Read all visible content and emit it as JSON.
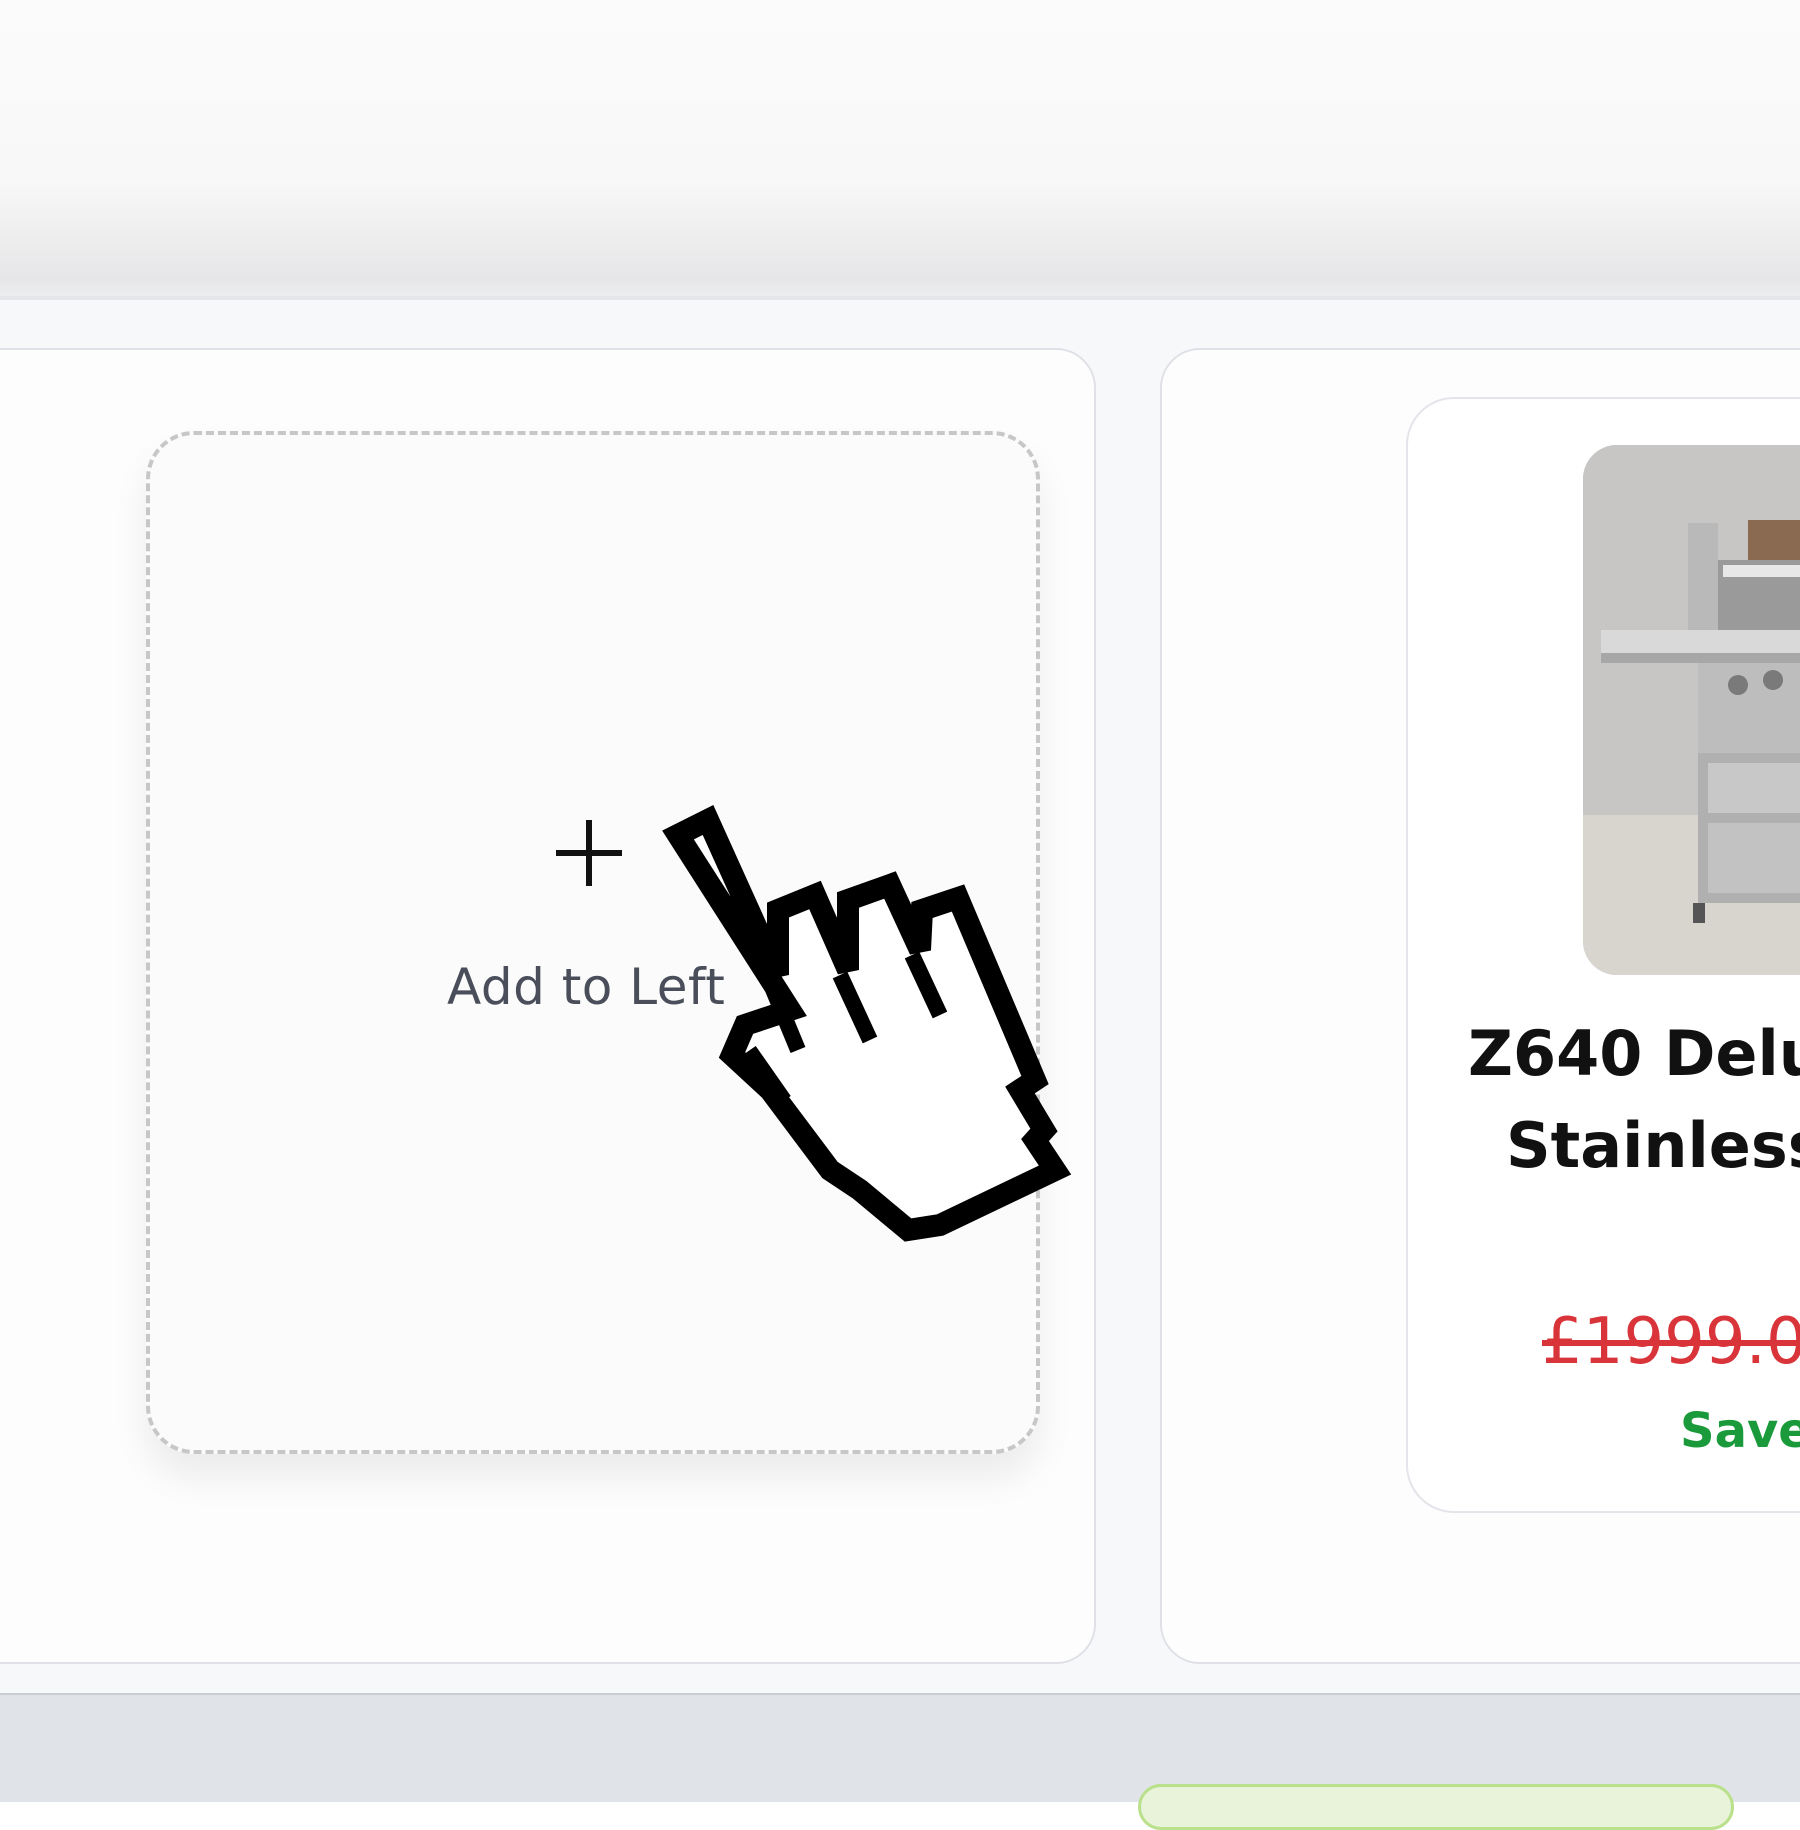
{
  "compare": {
    "left_slot": {
      "plus_icon": "plus-icon",
      "label": "Add to Left"
    },
    "right_slot": {
      "product": {
        "title_line1": "Z640 Delu",
        "title_line2": "Stainless",
        "old_price": "£1999.0",
        "save_text": "Save"
      }
    }
  },
  "cursor": {
    "icon": "hand-pointer-icon"
  },
  "colors": {
    "price_red": "#d9343a",
    "save_green": "#1b9a3b",
    "accent_lime": "#b9e08a"
  }
}
